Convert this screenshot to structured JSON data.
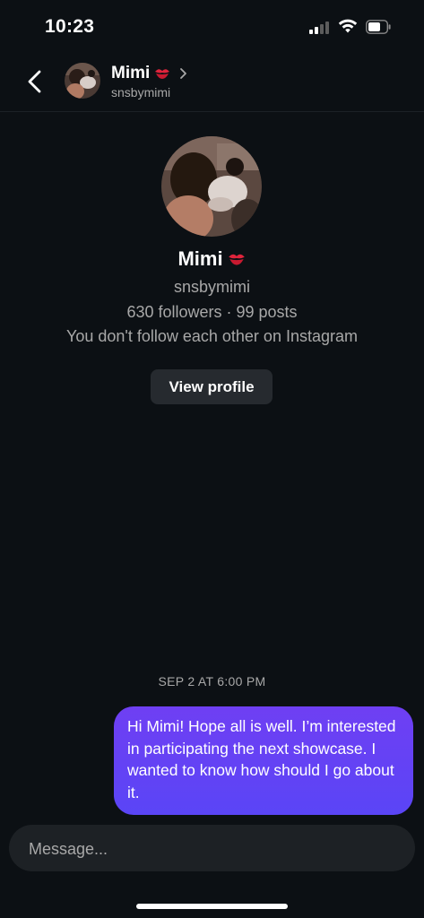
{
  "status_bar": {
    "time": "10:23"
  },
  "header": {
    "name": "Mimi",
    "username": "snsbymimi"
  },
  "profile": {
    "name": "Mimi",
    "username": "snsbymimi",
    "stats": "630 followers · 99 posts",
    "note": "You don't follow each other on Instagram",
    "view_profile_label": "View profile"
  },
  "conversation": {
    "timestamp": "SEP 2 AT 6:00 PM",
    "messages": [
      {
        "sender": "me",
        "text": "Hi Mimi! Hope all is well. I’m interested in participating the next showcase. I wanted to know how should I go about it."
      }
    ]
  },
  "composer": {
    "placeholder": "Message..."
  },
  "icons": {
    "back": "chevron-left-icon",
    "kiss": "kiss-mark-icon",
    "chevron": "chevron-right-icon"
  },
  "colors": {
    "background": "#0c1014",
    "bubble_start": "#6f3ff3",
    "bubble_end": "#5a45f6",
    "secondary_text": "#a8a8a8",
    "button_bg": "#262a2f",
    "composer_bg": "#1d2125"
  }
}
